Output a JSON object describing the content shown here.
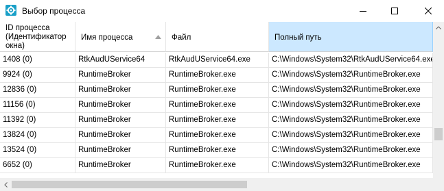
{
  "window": {
    "title": "Выбор процесса",
    "accent": "#1aa0c8"
  },
  "table": {
    "columns": [
      {
        "label": "ID процесса\n(Идентификатор\nокна)"
      },
      {
        "label": "Имя процесса",
        "sorted": "ascending"
      },
      {
        "label": "Файл"
      },
      {
        "label": "Полный путь",
        "selected": true
      }
    ],
    "rows": [
      {
        "id": "1408 (0)",
        "name": "RtkAudUService64",
        "file": "RtkAudUService64.exe",
        "path": "C:\\Windows\\System32\\RtkAudUService64.exe"
      },
      {
        "id": "9924 (0)",
        "name": "RuntimeBroker",
        "file": "RuntimeBroker.exe",
        "path": "C:\\Windows\\System32\\RuntimeBroker.exe"
      },
      {
        "id": "12836 (0)",
        "name": "RuntimeBroker",
        "file": "RuntimeBroker.exe",
        "path": "C:\\Windows\\System32\\RuntimeBroker.exe"
      },
      {
        "id": "11156 (0)",
        "name": "RuntimeBroker",
        "file": "RuntimeBroker.exe",
        "path": "C:\\Windows\\System32\\RuntimeBroker.exe"
      },
      {
        "id": "11392 (0)",
        "name": "RuntimeBroker",
        "file": "RuntimeBroker.exe",
        "path": "C:\\Windows\\System32\\RuntimeBroker.exe"
      },
      {
        "id": "13824 (0)",
        "name": "RuntimeBroker",
        "file": "RuntimeBroker.exe",
        "path": "C:\\Windows\\System32\\RuntimeBroker.exe"
      },
      {
        "id": "13524 (0)",
        "name": "RuntimeBroker",
        "file": "RuntimeBroker.exe",
        "path": "C:\\Windows\\System32\\RuntimeBroker.exe"
      },
      {
        "id": "6652 (0)",
        "name": "RuntimeBroker",
        "file": "RuntimeBroker.exe",
        "path": "C:\\Windows\\System32\\RuntimeBroker.exe"
      }
    ]
  },
  "icons": {
    "app": "app-gear-icon",
    "minimize": "minimize-icon",
    "maximize": "maximize-icon",
    "close": "close-icon",
    "sort": "sort-up-icon",
    "scroll_up": "chevron-up-icon",
    "scroll_left": "chevron-left-icon"
  }
}
